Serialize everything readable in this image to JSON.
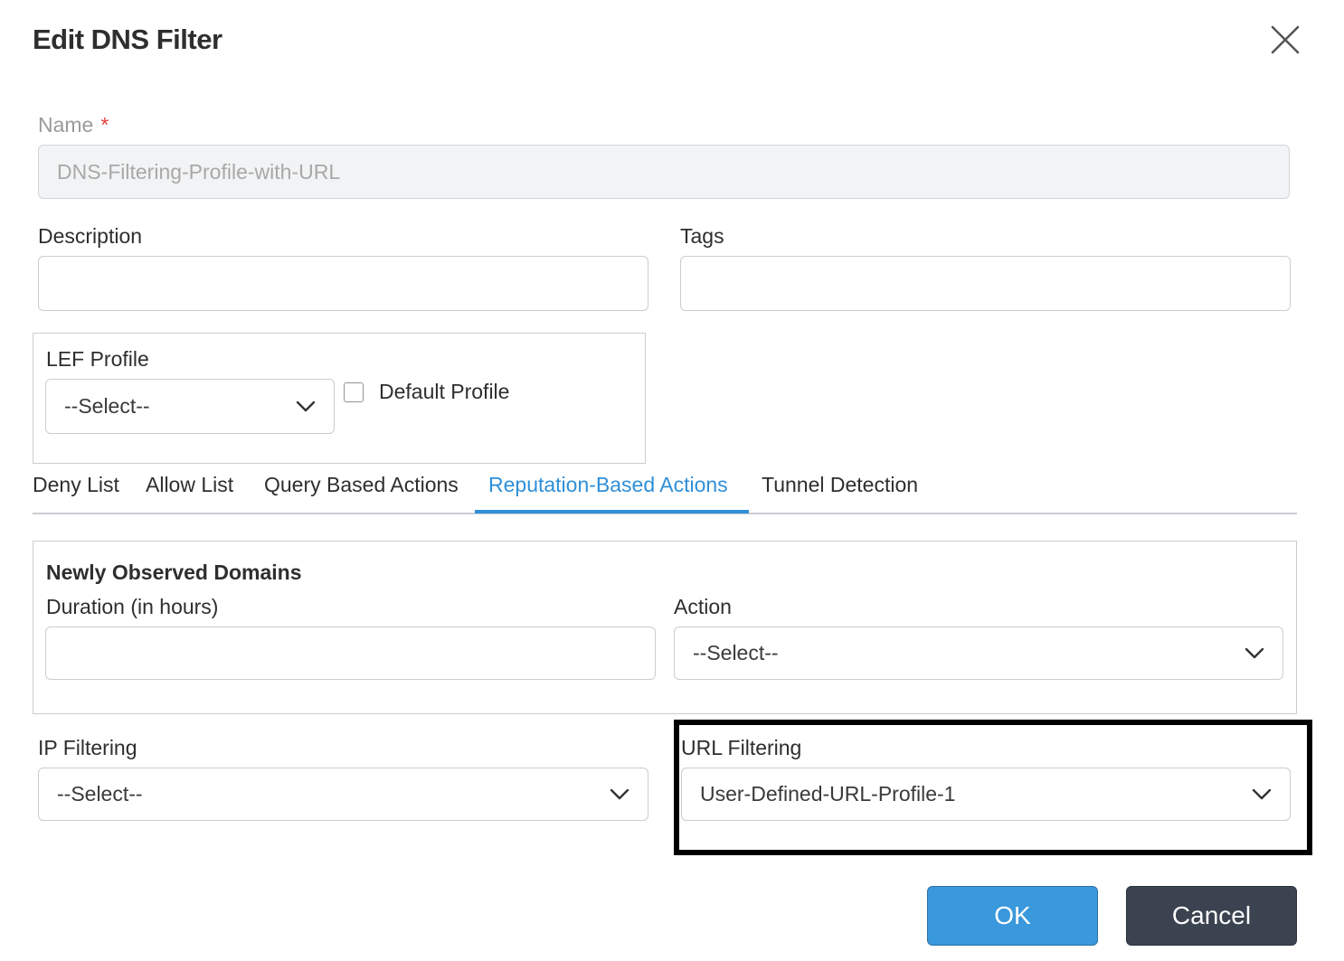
{
  "dialog": {
    "title": "Edit DNS Filter",
    "close_icon": "close-icon"
  },
  "name": {
    "label": "Name",
    "required_marker": "*",
    "value": "DNS-Filtering-Profile-with-URL"
  },
  "description": {
    "label": "Description",
    "value": ""
  },
  "tags": {
    "label": "Tags",
    "value": ""
  },
  "lef_profile": {
    "label": "LEF Profile",
    "selected": "--Select--",
    "default_profile_label": "Default Profile",
    "default_profile_checked": false
  },
  "tabs": [
    {
      "label": "Deny List",
      "active": false
    },
    {
      "label": "Allow List",
      "active": false
    },
    {
      "label": "Query Based Actions",
      "active": false
    },
    {
      "label": "Reputation-Based Actions",
      "active": true
    },
    {
      "label": "Tunnel Detection",
      "active": false
    }
  ],
  "newly_observed_domains": {
    "heading": "Newly Observed Domains",
    "duration_label": "Duration (in hours)",
    "duration_value": "",
    "action_label": "Action",
    "action_selected": "--Select--"
  },
  "ip_filtering": {
    "label": "IP Filtering",
    "selected": "--Select--"
  },
  "url_filtering": {
    "label": "URL Filtering",
    "selected": "User-Defined-URL-Profile-1"
  },
  "footer": {
    "ok_label": "OK",
    "cancel_label": "Cancel"
  },
  "colors": {
    "accent": "#2f8fd8",
    "ok_button": "#3a98dc",
    "cancel_button": "#3b4350",
    "required": "#e0403a",
    "highlight_frame": "#000000"
  }
}
